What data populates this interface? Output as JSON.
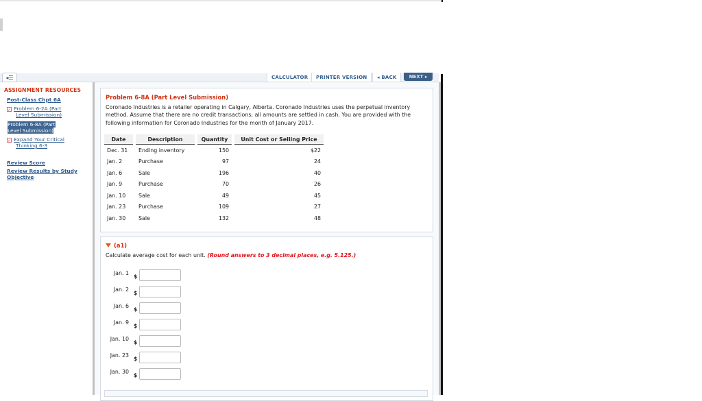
{
  "toolbar": {
    "collapse_icon": "collapse-sidebar-icon",
    "calculator_label": "CALCULATOR",
    "printer_label": "PRINTER VERSION",
    "back_label": "◂ BACK",
    "next_label": "NEXT ▸"
  },
  "sidebar": {
    "heading": "ASSIGNMENT RESOURCES",
    "section_link": "Post-Class Chpt 6A",
    "items": [
      {
        "line1": "Problem 6-2A (Part",
        "line2": "Level Submission)",
        "state": "checked-icon",
        "active": false
      },
      {
        "line1": "Problem 6-8A (Part",
        "line2": "Level Submission)",
        "state": "",
        "active": true
      },
      {
        "line1": "Expand Your Critical",
        "line2": "Thinking 6-3",
        "state": "checked-icon",
        "active": false
      }
    ],
    "review_score": "Review Score",
    "review_results_line1": "Review Results by Study",
    "review_results_line2": "Objective"
  },
  "problem": {
    "title": "Problem 6-8A (Part Level Submission)",
    "text": "Coronado Industries is a retailer operating in Calgary, Alberta. Coronado Industries uses the perpetual inventory method. Assume that there are no credit transactions; all amounts are settled in cash. You are provided with the following information for Coronado Industries for the month of January 2017.",
    "table": {
      "headers": [
        "Date",
        "Description",
        "Quantity",
        "Unit Cost or Selling Price"
      ],
      "rows": [
        [
          "Dec. 31",
          "Ending inventory",
          "150",
          "$22"
        ],
        [
          "Jan. 2",
          "Purchase",
          "97",
          "24"
        ],
        [
          "Jan. 6",
          "Sale",
          "196",
          "40"
        ],
        [
          "Jan. 9",
          "Purchase",
          "70",
          "26"
        ],
        [
          "Jan. 10",
          "Sale",
          "49",
          "45"
        ],
        [
          "Jan. 23",
          "Purchase",
          "109",
          "27"
        ],
        [
          "Jan. 30",
          "Sale",
          "132",
          "48"
        ]
      ]
    }
  },
  "part_a1": {
    "label": "(a1)",
    "instruction": "Calculate average cost for each unit.",
    "hint": "(Round answers to 3 decimal places, e.g. 5.125.)",
    "currency": "$",
    "answers": [
      {
        "date": "Jan. 1",
        "value": ""
      },
      {
        "date": "Jan. 2",
        "value": ""
      },
      {
        "date": "Jan. 6",
        "value": ""
      },
      {
        "date": "Jan. 9",
        "value": ""
      },
      {
        "date": "Jan. 10",
        "value": ""
      },
      {
        "date": "Jan. 23",
        "value": ""
      },
      {
        "date": "Jan. 30",
        "value": ""
      }
    ]
  },
  "colors": {
    "accent_red": "#d13212",
    "link_blue": "#2a5a8c",
    "hint_red": "#e4151f",
    "next_button": "#3b5f86"
  }
}
